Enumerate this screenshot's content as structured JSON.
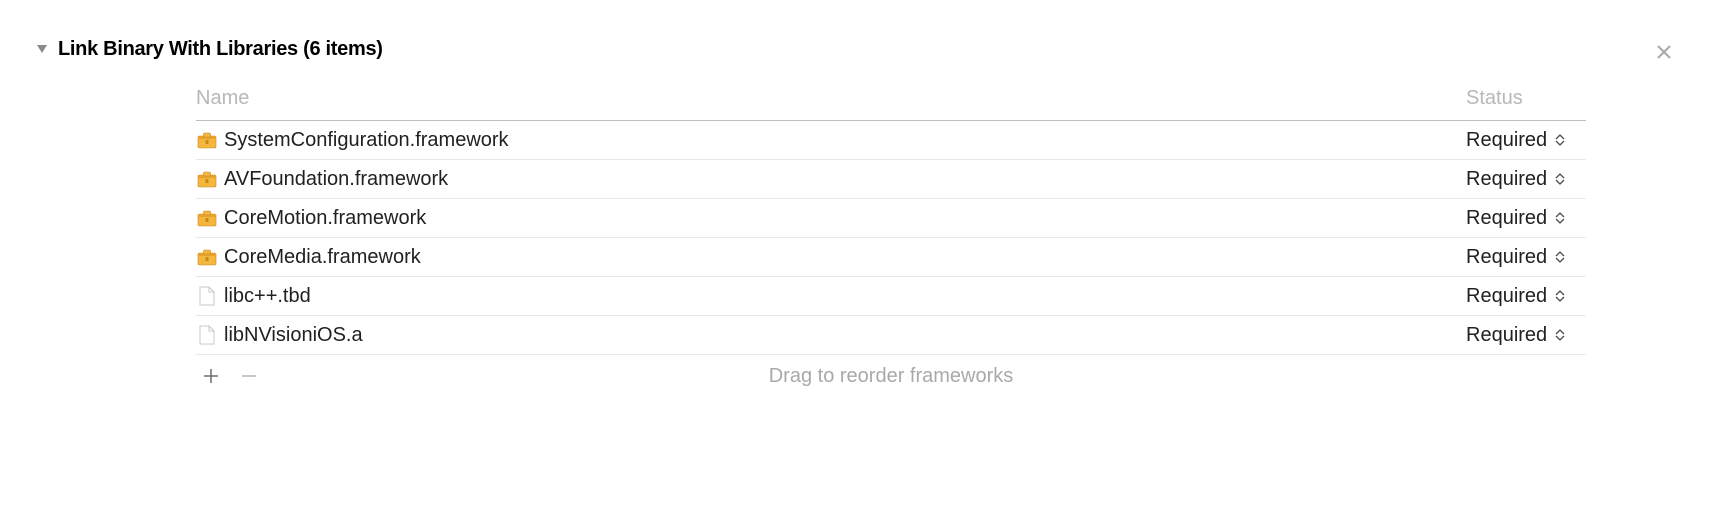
{
  "section": {
    "title": "Link Binary With Libraries (6 items)"
  },
  "columns": {
    "name": "Name",
    "status": "Status"
  },
  "rows": [
    {
      "icon": "framework",
      "name": "SystemConfiguration.framework",
      "status": "Required"
    },
    {
      "icon": "framework",
      "name": "AVFoundation.framework",
      "status": "Required"
    },
    {
      "icon": "framework",
      "name": "CoreMotion.framework",
      "status": "Required"
    },
    {
      "icon": "framework",
      "name": "CoreMedia.framework",
      "status": "Required"
    },
    {
      "icon": "file",
      "name": "libc++.tbd",
      "status": "Required"
    },
    {
      "icon": "file",
      "name": "libNVisioniOS.a",
      "status": "Required"
    }
  ],
  "footer": {
    "hint": "Drag to reorder frameworks"
  }
}
